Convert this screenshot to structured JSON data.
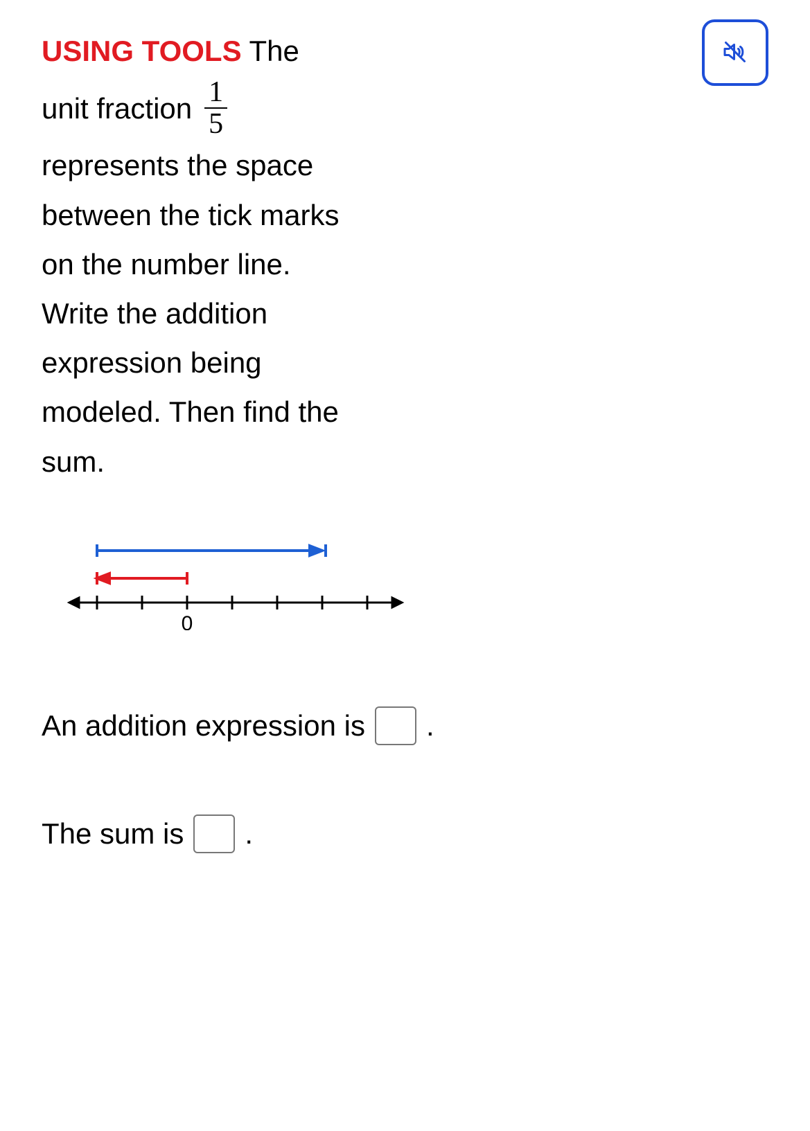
{
  "heading": "USING TOOLS",
  "prompt": {
    "w1": "The",
    "w2": "unit fraction",
    "frac_num": "1",
    "frac_den": "5",
    "rest1": " represents the space",
    "rest2": "between the tick marks",
    "rest3": "on the number line.",
    "rest4": "Write the addition",
    "rest5": "expression being",
    "rest6": "modeled. Then find the",
    "rest7": "sum."
  },
  "chart_data": {
    "type": "numberline",
    "tick_spacing_value": "1/5",
    "ticks": [
      -0.4,
      -0.2,
      0,
      0.2,
      0.4,
      0.6,
      0.8
    ],
    "labeled_ticks": {
      "0": "0"
    },
    "vectors": [
      {
        "name": "red",
        "color": "#e11b22",
        "from": 0,
        "to": -0.4,
        "direction": "left"
      },
      {
        "name": "blue",
        "color": "#1e60d4",
        "from": -0.4,
        "to": 0.6,
        "direction": "right"
      }
    ],
    "axis_arrows": "both"
  },
  "answers": {
    "expr_label": "An addition expression is",
    "sum_label": "The sum is",
    "period": "."
  },
  "icons": {
    "audio": "audio-muted-icon"
  }
}
